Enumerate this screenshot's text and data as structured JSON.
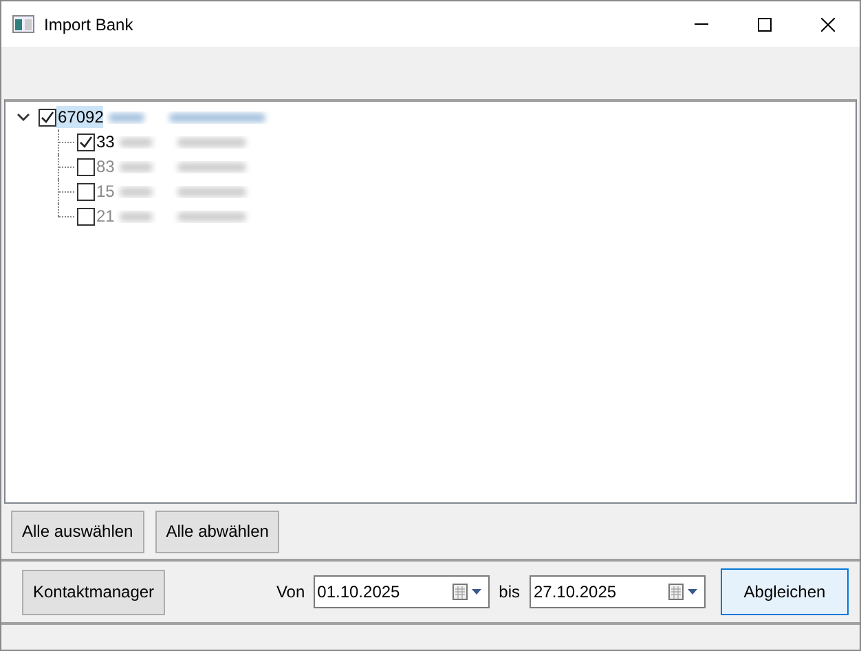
{
  "window": {
    "title": "Import Bank"
  },
  "tree": [
    {
      "label": "67092",
      "checked": true,
      "selected": true,
      "expanded": true,
      "disabled": false,
      "children": [
        {
          "label": "33",
          "checked": true,
          "selected": false,
          "disabled": false
        },
        {
          "label": "83",
          "checked": false,
          "selected": false,
          "disabled": true
        },
        {
          "label": "15",
          "checked": false,
          "selected": false,
          "disabled": true
        },
        {
          "label": "21",
          "checked": false,
          "selected": false,
          "disabled": true
        }
      ]
    }
  ],
  "selection_buttons": [
    "Alle auswählen",
    "Alle abwählen"
  ],
  "contact_button": "Kontaktmanager",
  "from": {
    "label": "Von",
    "value": "01.10.2025"
  },
  "to": {
    "label": "bis",
    "value": "27.10.2025"
  },
  "match_button": "Abgleichen"
}
